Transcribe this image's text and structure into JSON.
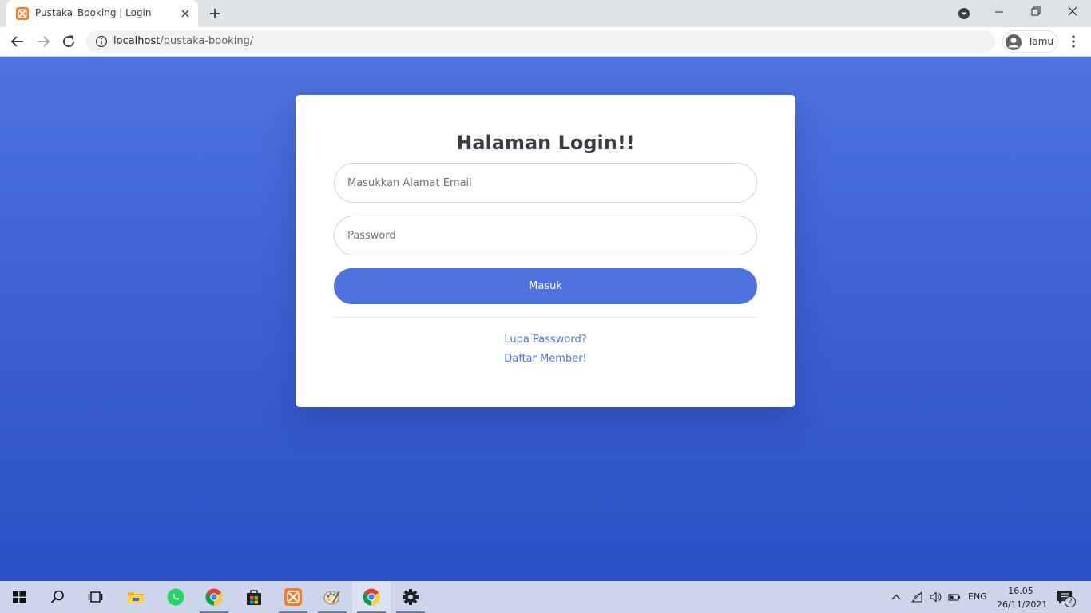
{
  "browser": {
    "tab_title": "Pustaka_Booking | Login",
    "url_host": "localhost",
    "url_path": "/pustaka-booking/",
    "profile_name": "Tamu"
  },
  "login": {
    "title": "Halaman Login!!",
    "email_placeholder": "Masukkan Alamat Email",
    "password_placeholder": "Password",
    "submit_label": "Masuk",
    "forgot_link": "Lupa Password?",
    "register_link": "Daftar Member!"
  },
  "taskbar": {
    "items": [
      "start-icon",
      "search-icon",
      "task-view-icon",
      "file-explorer-icon",
      "whatsapp-icon",
      "chrome-icon",
      "store-icon",
      "xampp-icon",
      "paint-icon",
      "chrome-icon",
      "settings-icon"
    ],
    "language": "ENG",
    "time": "16.05",
    "date": "26/11/2021",
    "notification_count": "2"
  },
  "colors": {
    "primary": "#4e73df",
    "page_gradient_bottom": "#2b50c5",
    "taskbar": "#ccd5ea"
  }
}
